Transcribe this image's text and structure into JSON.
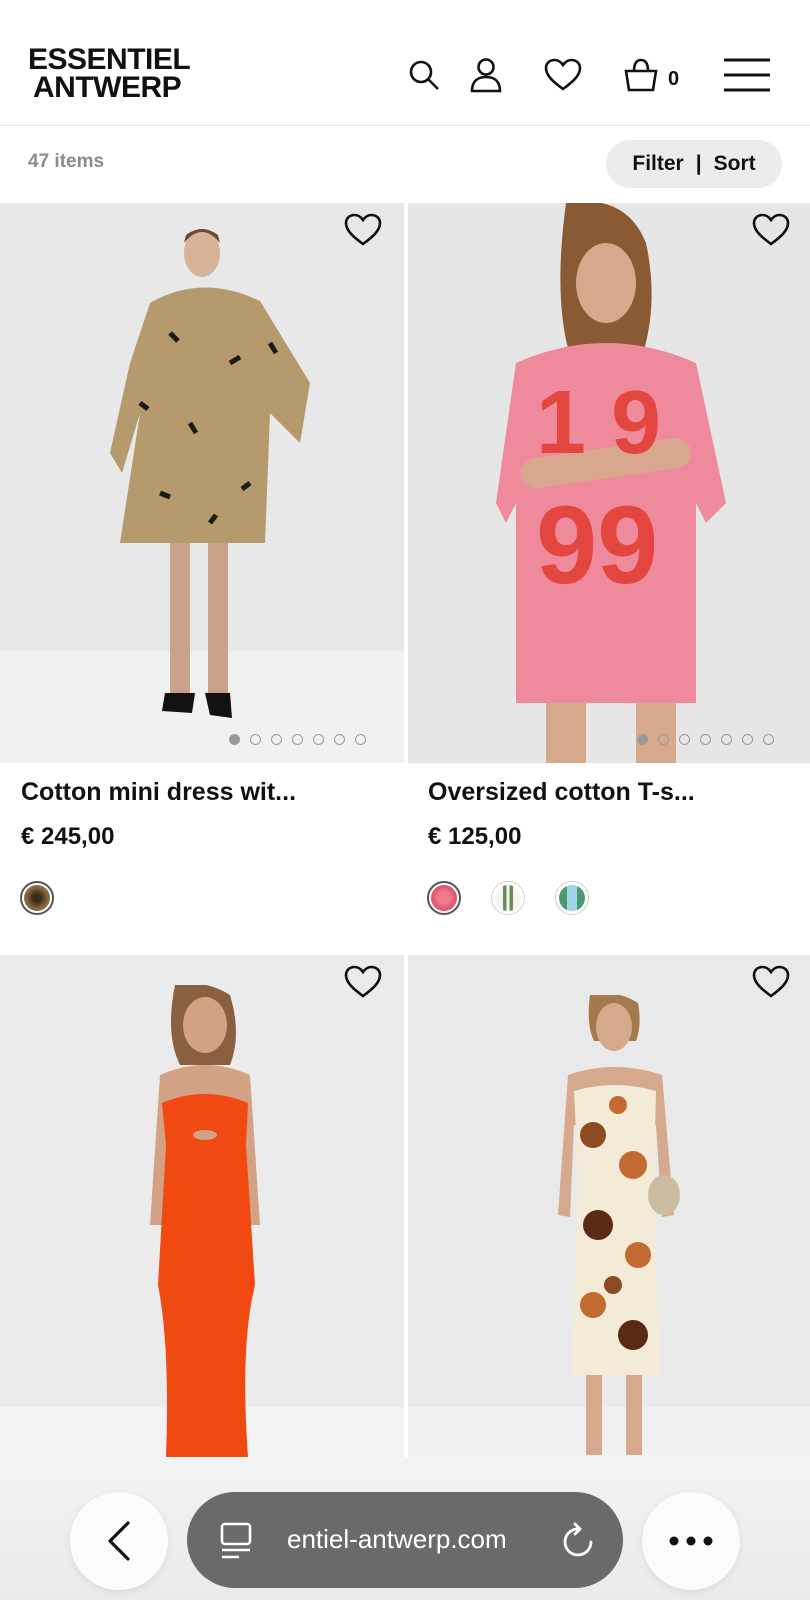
{
  "header": {
    "logo_line1": "ESSENTIEL",
    "logo_line2": "ANTWERP",
    "cart_count": "0",
    "icons": [
      "search-icon",
      "account-icon",
      "wishlist-icon",
      "cart-icon",
      "menu-icon"
    ]
  },
  "listing": {
    "items_count": "47 items",
    "filter_label": "Filter",
    "separator": "|",
    "sort_label": "Sort"
  },
  "products": [
    {
      "name": "Cotton mini dress wit...",
      "price": "€  245,00",
      "image_dots": 7,
      "active_dot": 0,
      "swatches": [
        "#8b6a3e"
      ]
    },
    {
      "name": "Oversized cotton T-s...",
      "price": "€  125,00",
      "image_dots": 7,
      "active_dot": 0,
      "swatches": [
        "#e0566e",
        "#6b8a58",
        "#8fc7d8"
      ]
    },
    {
      "name": "",
      "price": ""
    },
    {
      "name": "",
      "price": ""
    }
  ],
  "browser": {
    "url": "entiel-antwerp.com",
    "icons": [
      "back-icon",
      "tabs-icon",
      "reload-icon",
      "more-icon"
    ]
  },
  "colors": {
    "pill_bg": "#ececec",
    "url_bar_bg": "#6a6a6a",
    "muted_text": "#8b8b8b"
  }
}
